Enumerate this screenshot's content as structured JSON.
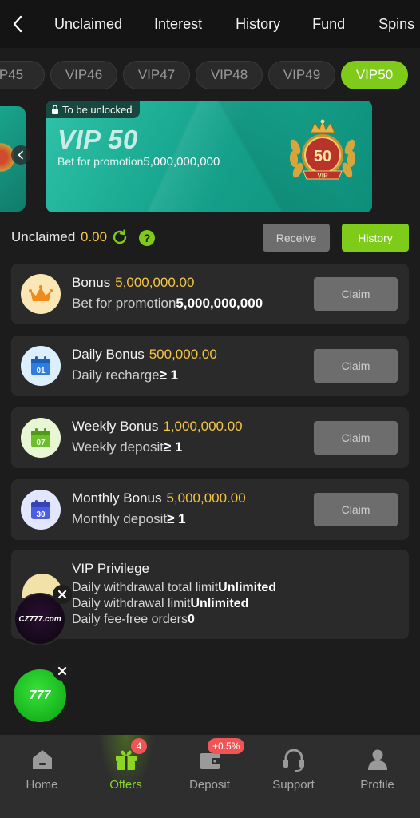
{
  "nav": {
    "tabs": [
      "Unclaimed",
      "Interest",
      "History",
      "Fund",
      "Spins"
    ]
  },
  "vip_levels": [
    "P45",
    "VIP46",
    "VIP47",
    "VIP48",
    "VIP49",
    "VIP50"
  ],
  "vip_selected": "VIP50",
  "vip_card": {
    "lock_text": "To be unlocked",
    "title": "VIP 50",
    "promo_label": "Bet for promotion",
    "promo_amount": "5,000,000,000",
    "badge_number": "50",
    "badge_text": "VIP"
  },
  "unclaimed": {
    "label": "Unclaimed",
    "value": "0.00",
    "help_glyph": "?",
    "receive_label": "Receive",
    "history_label": "History"
  },
  "bonuses": [
    {
      "name": "Bonus",
      "amount": "5,000,000.00",
      "req_label": "Bet for promotion",
      "req_value": "5,000,000,000",
      "icon": "crown-icon",
      "claim": "Claim"
    },
    {
      "name": "Daily Bonus",
      "amount": "500,000.00",
      "req_label": "Daily recharge",
      "req_value": "≥ 1",
      "icon": "calendar-01-icon",
      "day": "01",
      "claim": "Claim"
    },
    {
      "name": "Weekly Bonus",
      "amount": "1,000,000.00",
      "req_label": "Weekly deposit",
      "req_value": "≥ 1",
      "icon": "calendar-07-icon",
      "day": "07",
      "claim": "Claim"
    },
    {
      "name": "Monthly Bonus",
      "amount": "5,000,000.00",
      "req_label": "Monthly deposit",
      "req_value": "≥ 1",
      "icon": "calendar-30-icon",
      "day": "30",
      "claim": "Claim"
    }
  ],
  "privilege": {
    "title": "VIP Privilege",
    "lines": [
      {
        "label": "Daily withdrawal total limit",
        "value": "Unlimited"
      },
      {
        "label": "Daily withdrawal limit",
        "value": "Unlimited"
      },
      {
        "label": "Daily fee-free orders",
        "value": "0"
      }
    ]
  },
  "floating_ads": {
    "cz_text": "CZ777.com",
    "brand_text": "777"
  },
  "bottom_nav": [
    {
      "label": "Home",
      "icon": "home-icon"
    },
    {
      "label": "Offers",
      "icon": "gift-icon",
      "badge": "4"
    },
    {
      "label": "Deposit",
      "icon": "wallet-icon",
      "badge": "+0.5%"
    },
    {
      "label": "Support",
      "icon": "headset-icon"
    },
    {
      "label": "Profile",
      "icon": "person-icon"
    }
  ],
  "colors": {
    "accent": "#7ecb1a",
    "gold": "#f5c541",
    "card_bg": "#2a2a2a",
    "vip_teal": "#16a48e",
    "badge_red": "#f05454"
  }
}
